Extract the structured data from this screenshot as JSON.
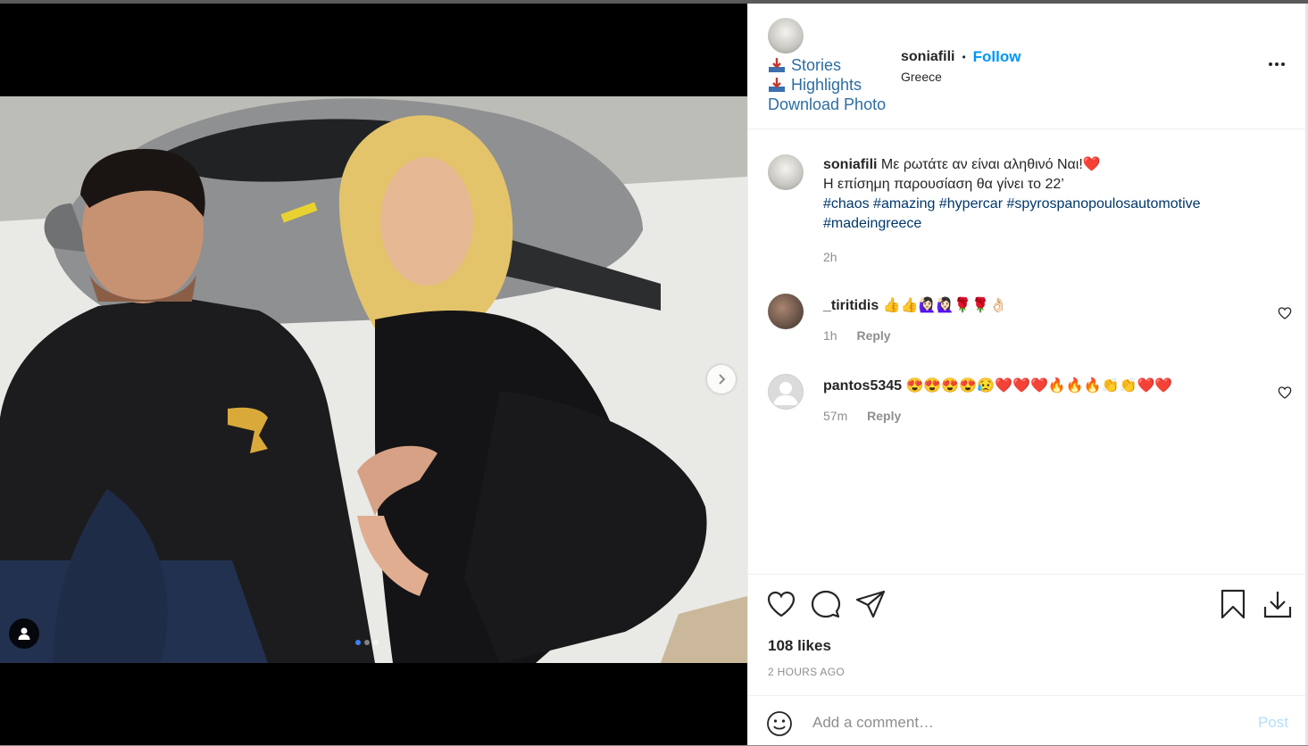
{
  "post": {
    "username": "soniafili",
    "follow_label": "Follow",
    "separator": "•",
    "location": "Greece",
    "ext_links": [
      "Stories",
      "Highlights",
      "Download Photo"
    ],
    "caption_line1": "Με ρωτάτε αν είναι αληθινό Ναι!❤️",
    "caption_line2": "Η επίσημη παρουσίαση θα γίνει το 22’",
    "hashtags_line1": [
      "#chaos",
      "#amazing",
      "#hypercar",
      "#spyrospanopoulosautomotive"
    ],
    "hashtags_line2": [
      "#madeingreece"
    ],
    "caption_time": "2h"
  },
  "comments": [
    {
      "username": "_tiritidis",
      "text": "👍👍🙋🏻‍♀️🙋🏻‍♀️🌹🌹👌🏻",
      "time": "1h",
      "reply_label": "Reply"
    },
    {
      "username": "pantos5345",
      "text": "😍😍😍😍😥❤️❤️❤️🔥🔥🔥👏👏❤️❤️",
      "time": "57m",
      "reply_label": "Reply"
    }
  ],
  "likes": "108 likes",
  "time_ago": "2 HOURS AGO",
  "add_comment": {
    "placeholder": "Add a comment…",
    "post_label": "Post"
  },
  "colors": {
    "accent": "#0095f6",
    "link": "#00376b",
    "ext_link": "#2d6da3",
    "muted": "#8e8e8e"
  },
  "carousel": {
    "slides": 3,
    "active": 1
  }
}
